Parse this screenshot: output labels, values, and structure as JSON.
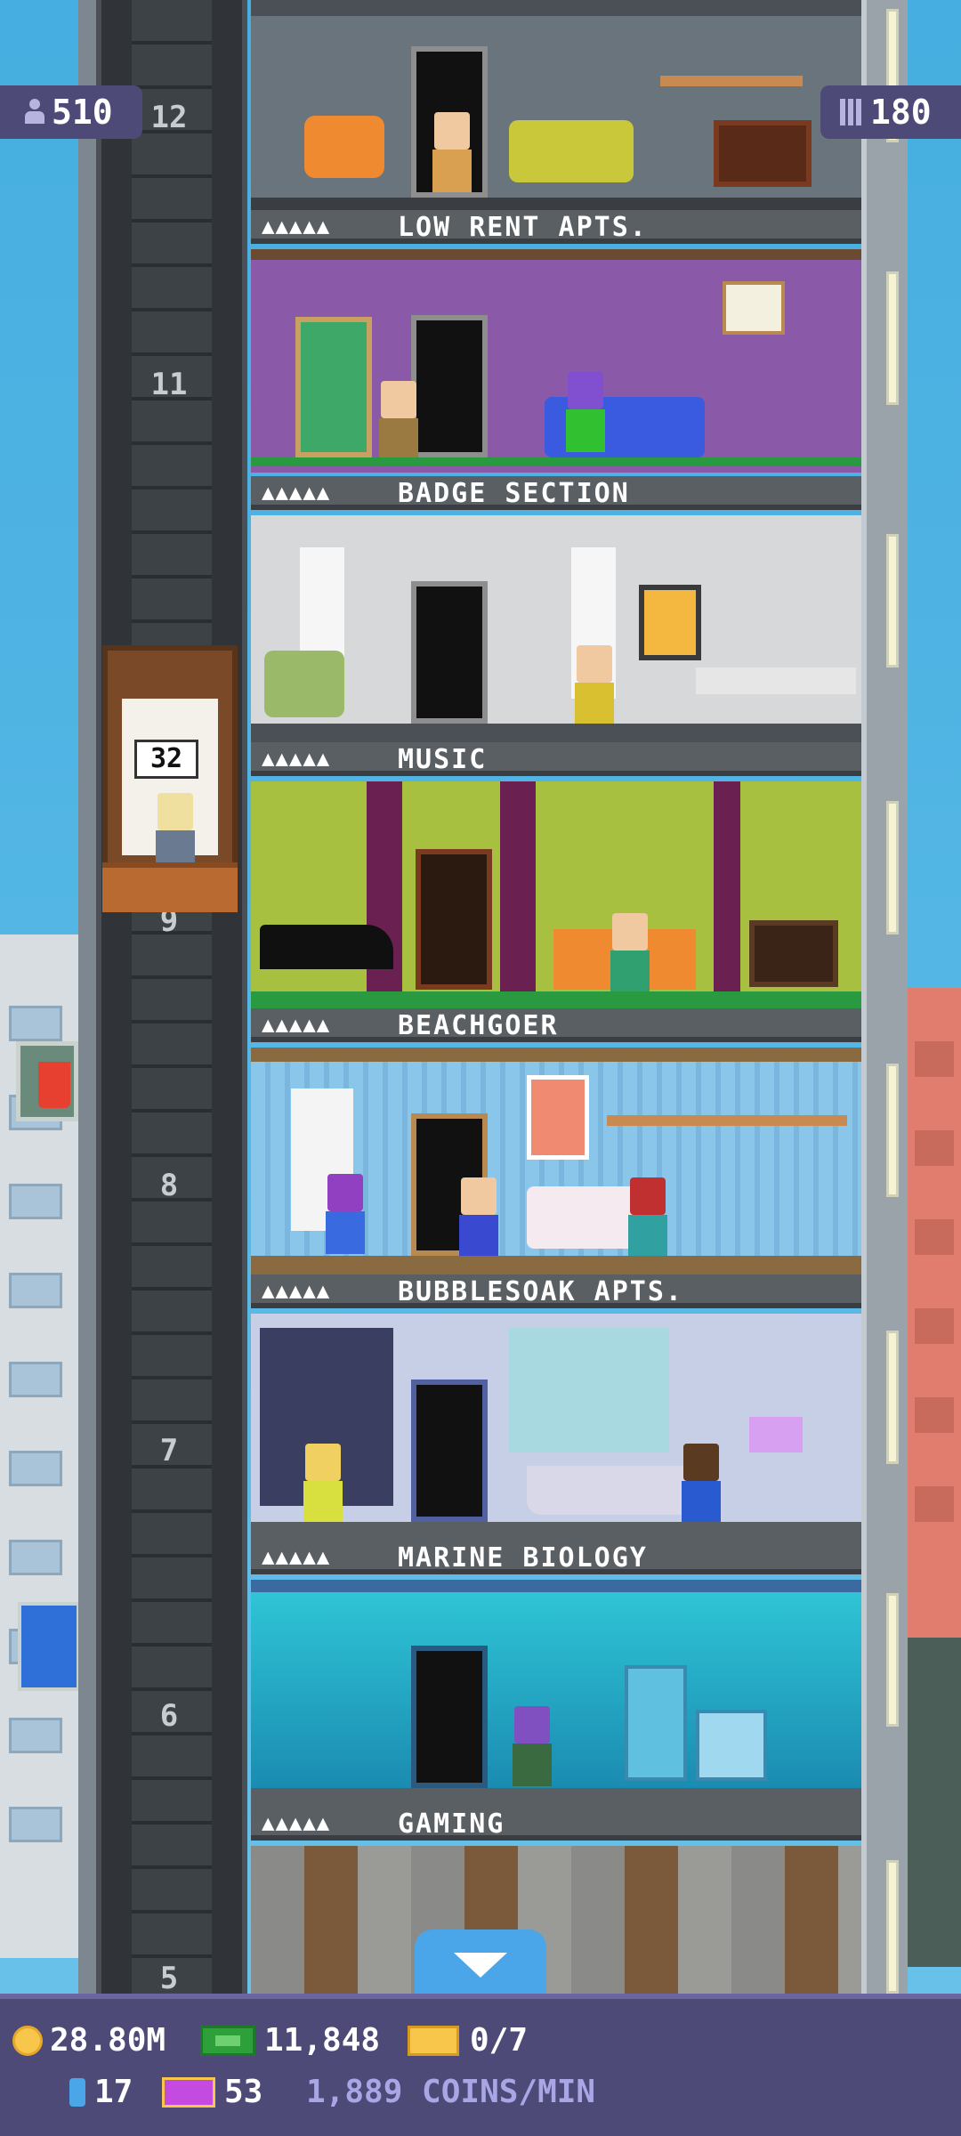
{
  "hud": {
    "population": "510",
    "floors": "180"
  },
  "elevator": {
    "count": "32"
  },
  "shaft_numbers": [
    "12",
    "11",
    "9",
    "8",
    "7",
    "6",
    "5"
  ],
  "floors": [
    {
      "label": "LOW RENT APTS.",
      "stars": "▲▲▲▲▲"
    },
    {
      "label": "BADGE SECTION",
      "stars": "▲▲▲▲▲"
    },
    {
      "label": "MUSIC",
      "stars": "▲▲▲▲▲"
    },
    {
      "label": "BEACHGOER",
      "stars": "▲▲▲▲▲"
    },
    {
      "label": "BUBBLESOAK APTS.",
      "stars": "▲▲▲▲▲"
    },
    {
      "label": "MARINE BIOLOGY",
      "stars": "▲▲▲▲▲"
    },
    {
      "label": "GAMING",
      "stars": "▲▲▲▲▲"
    }
  ],
  "bottom": {
    "coins": "28.80M",
    "bux": "11,848",
    "tickets": "0/7",
    "cylinders": "17",
    "vip": "53",
    "rate": "1,889 COINS/MIN"
  },
  "colors": {
    "hud_bg": "#4d4a78",
    "coin": "#f7c64a",
    "bux": "#2da03a",
    "scroll_button": "#4aa6e8"
  },
  "icons": [
    "person-icon",
    "floors-icon",
    "coin-icon",
    "bux-icon",
    "ticket-icon",
    "cylinder-icon",
    "vip-icon",
    "chevron-down-icon"
  ]
}
